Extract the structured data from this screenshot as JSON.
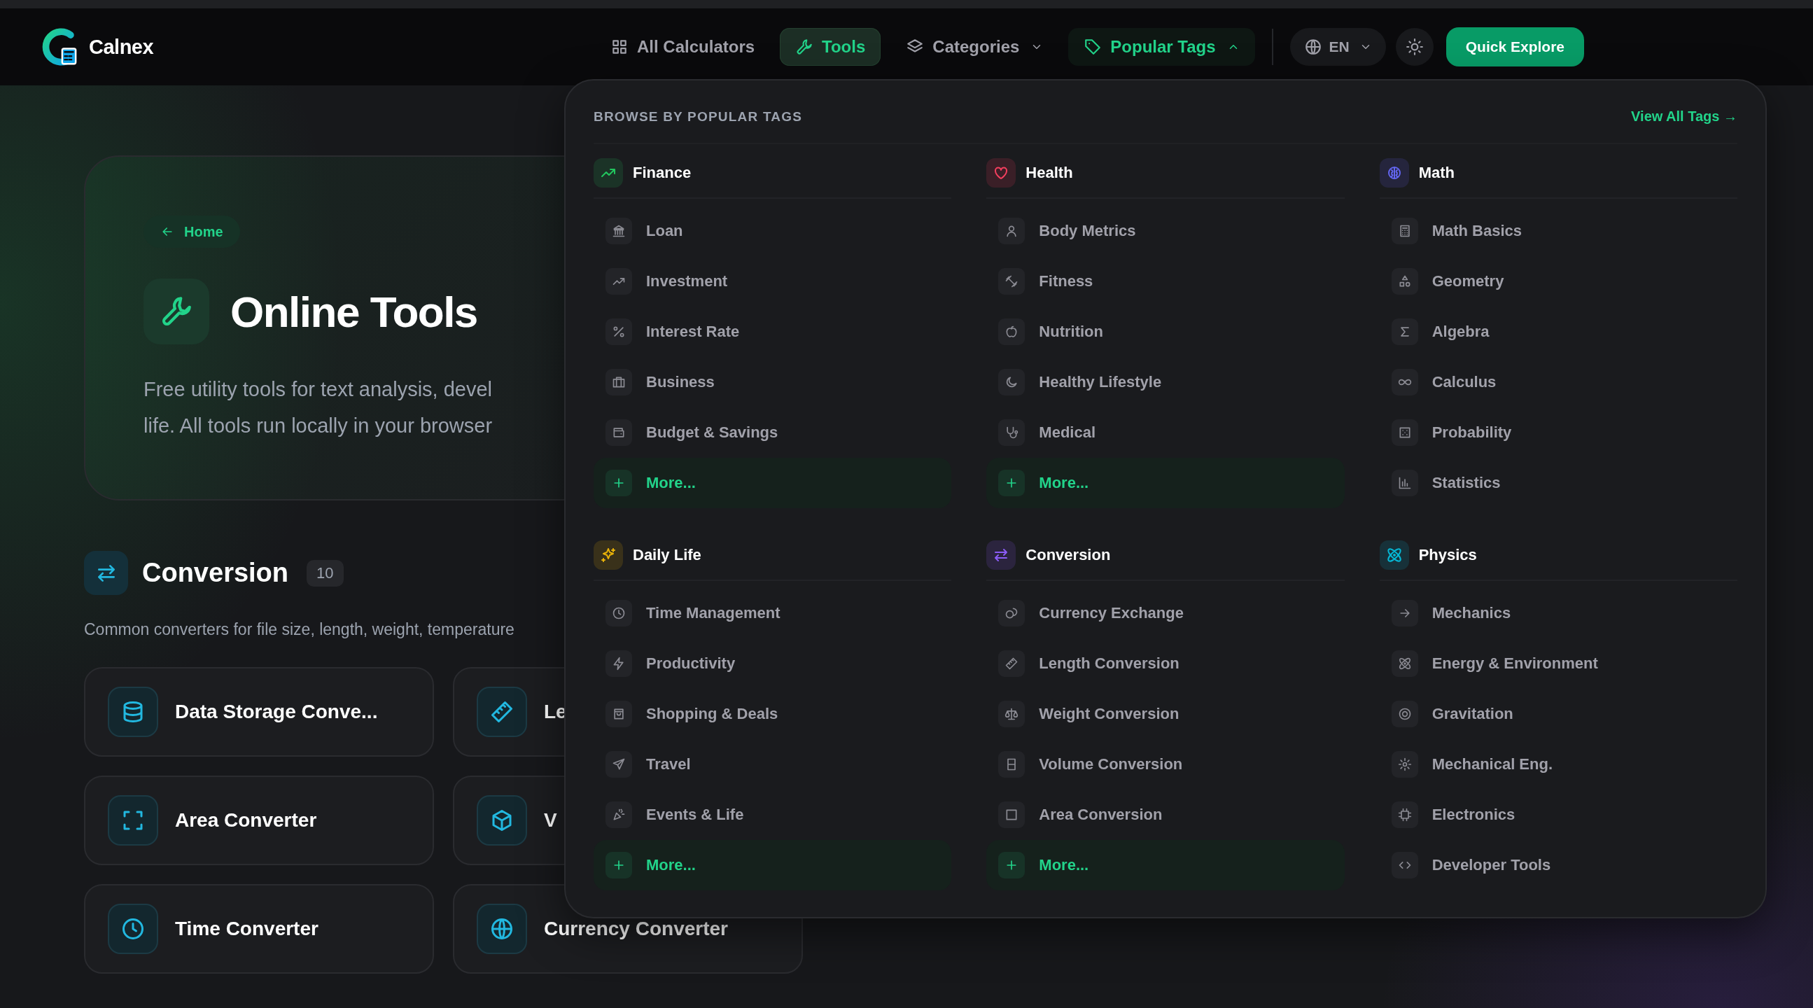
{
  "header": {
    "brand": "Calnex",
    "nav": [
      {
        "kind": "link",
        "label": "All Calculators",
        "selected": false,
        "expanded": false
      },
      {
        "kind": "link",
        "label": "Tools",
        "selected": true,
        "expanded": false
      },
      {
        "kind": "menu",
        "label": "Categories",
        "selected": false,
        "expanded": false
      },
      {
        "kind": "menu",
        "label": "Popular Tags",
        "selected": false,
        "expanded": true
      }
    ],
    "language": "EN",
    "cta": "Quick Explore"
  },
  "hero": {
    "back_link": "Home",
    "title": "Online Tools",
    "description_lines": [
      "Free utility tools for text analysis, devel",
      "life. All tools run locally in your browser"
    ]
  },
  "section": {
    "title": "Conversion",
    "count": "10",
    "description": "Common converters for file size, length, weight, temperature",
    "cards": [
      {
        "title": "Data Storage Conve..."
      },
      {
        "title": "Le"
      },
      {
        "title": "Area Converter"
      },
      {
        "title": "V"
      },
      {
        "title": "Time Converter"
      },
      {
        "title": "Currency Converter"
      }
    ]
  },
  "tags_menu": {
    "title": "BROWSE BY POPULAR TAGS",
    "link": "View All Tags →",
    "groups": [
      {
        "name": "Finance",
        "color": "#22c55e",
        "items": [
          {
            "kind": "tag",
            "label": "Loan"
          },
          {
            "kind": "tag",
            "label": "Investment"
          },
          {
            "kind": "tag",
            "label": "Interest Rate"
          },
          {
            "kind": "tag",
            "label": "Business"
          },
          {
            "kind": "tag",
            "label": "Budget & Savings"
          },
          {
            "kind": "more",
            "label": "More..."
          }
        ]
      },
      {
        "name": "Health",
        "color": "#f43f5e",
        "items": [
          {
            "kind": "tag",
            "label": "Body Metrics"
          },
          {
            "kind": "tag",
            "label": "Fitness"
          },
          {
            "kind": "tag",
            "label": "Nutrition"
          },
          {
            "kind": "tag",
            "label": "Healthy Lifestyle"
          },
          {
            "kind": "tag",
            "label": "Medical"
          },
          {
            "kind": "more",
            "label": "More..."
          }
        ]
      },
      {
        "name": "Math",
        "color": "#6366f1",
        "items": [
          {
            "kind": "tag",
            "label": "Math Basics"
          },
          {
            "kind": "tag",
            "label": "Geometry"
          },
          {
            "kind": "tag",
            "label": "Algebra"
          },
          {
            "kind": "tag",
            "label": "Calculus"
          },
          {
            "kind": "tag",
            "label": "Probability"
          },
          {
            "kind": "tag",
            "label": "Statistics"
          }
        ]
      },
      {
        "name": "Daily Life",
        "color": "#eab308",
        "items": [
          {
            "kind": "tag",
            "label": "Time Management"
          },
          {
            "kind": "tag",
            "label": "Productivity"
          },
          {
            "kind": "tag",
            "label": "Shopping & Deals"
          },
          {
            "kind": "tag",
            "label": "Travel"
          },
          {
            "kind": "tag",
            "label": "Events & Life"
          },
          {
            "kind": "more",
            "label": "More..."
          }
        ]
      },
      {
        "name": "Conversion",
        "color": "#8b5cf6",
        "items": [
          {
            "kind": "tag",
            "label": "Currency Exchange"
          },
          {
            "kind": "tag",
            "label": "Length Conversion"
          },
          {
            "kind": "tag",
            "label": "Weight Conversion"
          },
          {
            "kind": "tag",
            "label": "Volume Conversion"
          },
          {
            "kind": "tag",
            "label": "Area Conversion"
          },
          {
            "kind": "more",
            "label": "More..."
          }
        ]
      },
      {
        "name": "Physics",
        "color": "#06b6d4",
        "items": [
          {
            "kind": "tag",
            "label": "Mechanics"
          },
          {
            "kind": "tag",
            "label": "Energy & Environment"
          },
          {
            "kind": "tag",
            "label": "Gravitation"
          },
          {
            "kind": "tag",
            "label": "Mechanical Eng."
          },
          {
            "kind": "tag",
            "label": "Electronics"
          },
          {
            "kind": "tag",
            "label": "Developer Tools"
          }
        ]
      }
    ]
  }
}
